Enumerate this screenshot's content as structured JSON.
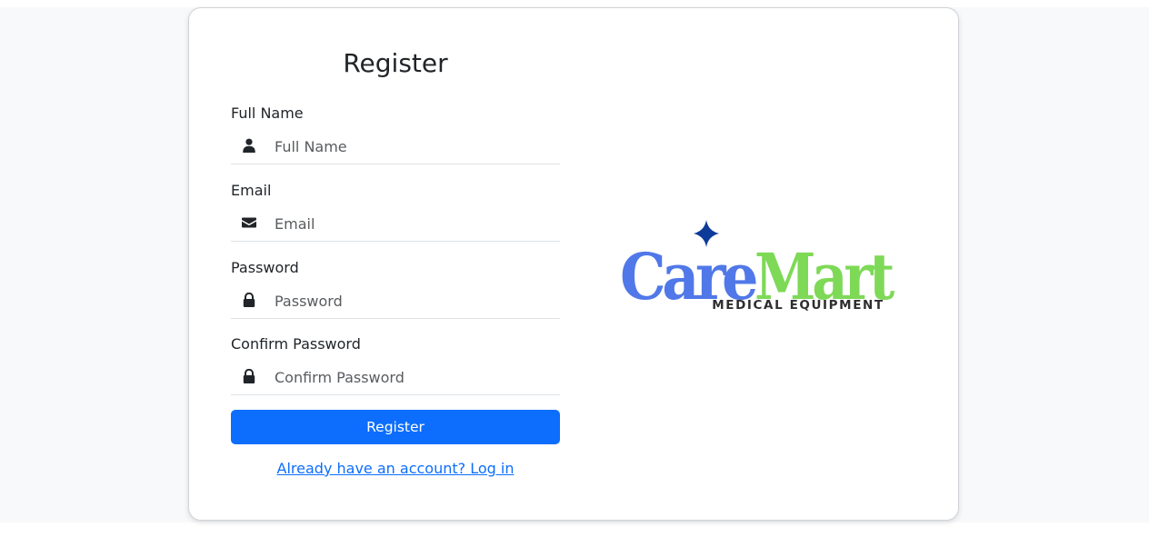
{
  "form": {
    "title": "Register",
    "fields": [
      {
        "label": "Full Name",
        "placeholder": "Full Name",
        "icon": "user-icon",
        "type": "text"
      },
      {
        "label": "Email",
        "placeholder": "Email",
        "icon": "envelope-icon",
        "type": "email"
      },
      {
        "label": "Password",
        "placeholder": "Password",
        "icon": "lock-icon",
        "type": "password"
      },
      {
        "label": "Confirm Password",
        "placeholder": "Confirm Password",
        "icon": "lock-icon",
        "type": "password"
      }
    ],
    "submit_label": "Register",
    "login_link_text": "Already have an account? Log in"
  },
  "logo": {
    "word_part1": "Care",
    "word_part2": "Mart",
    "tagline": "MEDICAL EQUIPMENT",
    "color_part1": "#5078e8",
    "color_part2": "#7ed957",
    "star_color": "#0d3b99"
  },
  "colors": {
    "primary": "#0d6efd",
    "background": "#f8f9fa"
  }
}
